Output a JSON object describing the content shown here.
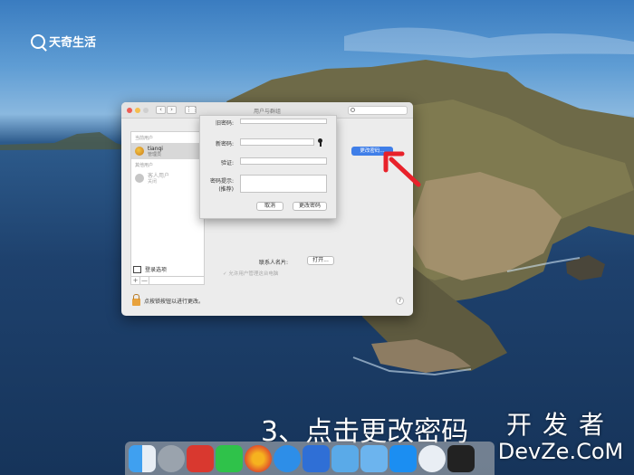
{
  "brand": {
    "logo_text": "天奇生活"
  },
  "window": {
    "title": "用户与群组",
    "search_placeholder": "",
    "sidebar": {
      "section_current": "当前用户",
      "section_other": "其他用户",
      "users": [
        {
          "name": "tianqi",
          "role": "管理员",
          "selected": true
        },
        {
          "name": "客人用户",
          "role": "关闭",
          "selected": false
        }
      ],
      "login_options": "登录选项",
      "add_label": "+",
      "remove_label": "—"
    },
    "change_password_button": "更改密码...",
    "contacts_label": "联系人名片:",
    "open_button": "打开...",
    "allow_admin_label": "允许用户管理这台电脑",
    "lock_text": "点按锁按钮以进行更改。",
    "help_label": "?"
  },
  "password_sheet": {
    "old_password_label": "旧密码:",
    "new_password_label": "新密码:",
    "verify_label": "验证:",
    "hint_label": "密码提示:",
    "hint_sublabel": "(推荐)",
    "cancel_button": "取消",
    "confirm_button": "更改密码"
  },
  "subtitle": "3、点击更改密码",
  "watermark": {
    "cn": "开发者",
    "en": "DevZe.CoM"
  },
  "dock": {
    "apps": [
      "finder-icon",
      "launchpad-icon",
      "app-g-icon",
      "wechat-icon",
      "firefox-icon",
      "safari-icon",
      "xcode-icon",
      "folder-icon",
      "folder-icon",
      "app-store-icon",
      "upload-icon",
      "terminal-icon",
      "system-preferences-icon",
      "preview-icon",
      "trash-icon"
    ]
  },
  "colors": {
    "accent_button": "#3f7ee8",
    "arrow": "#e8212a",
    "lock": "#e8a23c"
  }
}
